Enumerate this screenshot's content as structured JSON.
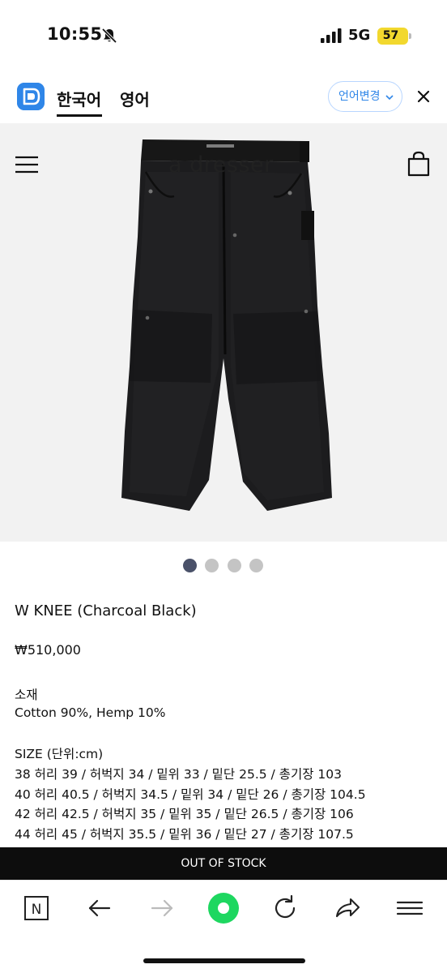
{
  "status_bar": {
    "time": "10:55",
    "network": "5G",
    "battery": "57",
    "icons": [
      "bell-slash-icon",
      "signal-icon"
    ]
  },
  "language_bar": {
    "active_tab": "한국어",
    "inactive_tab": "영어",
    "change_button": "언어변경",
    "icons": [
      "app-logo-icon",
      "chevron-down-icon",
      "close-icon"
    ]
  },
  "header": {
    "site_logo": "a dresser",
    "icons": [
      "menu-icon",
      "shopping-bag-icon"
    ]
  },
  "carousel": {
    "slide_count": 4,
    "active_index": 0
  },
  "product": {
    "title": "W KNEE (Charcoal Black)",
    "price": "₩510,000",
    "material_label": "소재",
    "material_value": "Cotton 90%, Hemp 10%",
    "size_label": "SIZE (단위:cm)",
    "size_rows": [
      "38 허리 39 / 허벅지 34 / 밑위 33 / 밑단 25.5 / 총기장 103",
      "40 허리 40.5 / 허벅지 34.5 / 밑위 34 / 밑단 26 / 총기장 104.5",
      "42 허리 42.5 / 허벅지 35 / 밑위 35 / 밑단 26.5 / 총기장 106",
      "44 허리 45 / 허벅지 35.5 / 밑위 36 / 밑단 27 / 총기장 107.5"
    ]
  },
  "stock_button": "OUT OF STOCK",
  "browser_toolbar": {
    "n_label": "N",
    "icons": [
      "naver-n-icon",
      "back-arrow-icon",
      "forward-arrow-icon",
      "home-circle-icon",
      "refresh-icon",
      "share-icon",
      "hamburger-icon"
    ],
    "accent": "#1ed760"
  },
  "colors": {
    "accent_blue": "#2f86e8",
    "battery_yellow": "#f2d82e",
    "dot_active": "#4a5169",
    "dot_inactive": "#c4c4c4"
  }
}
